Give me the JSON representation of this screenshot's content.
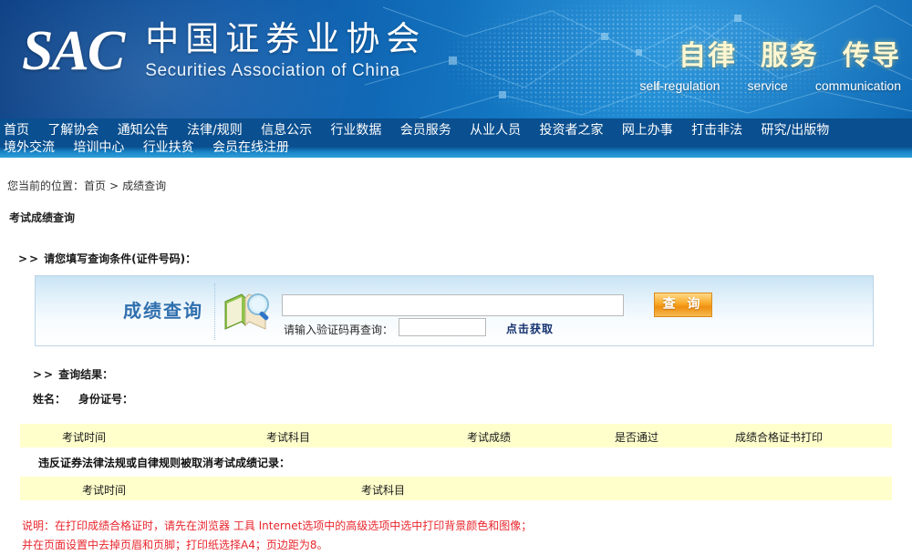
{
  "banner": {
    "logo_text": "SAC",
    "org_name_cn": "中国证券业协会",
    "org_name_en": "Securities Association of China",
    "slogans_cn": [
      "自律",
      "服务",
      "传导"
    ],
    "slogans_en": [
      "self-regulation",
      "service",
      "communication"
    ]
  },
  "nav": {
    "items": [
      "首页",
      "了解协会",
      "通知公告",
      "法律/规则",
      "信息公示",
      "行业数据",
      "会员服务",
      "从业人员",
      "投资者之家",
      "网上办事",
      "打击非法",
      "研究/出版物",
      "境外交流",
      "培训中心",
      "行业扶贫",
      "会员在线注册"
    ]
  },
  "breadcrumb": {
    "prefix": "您当前的位置：",
    "home": "首页",
    "separator": ">",
    "current": "成绩查询"
  },
  "page": {
    "section_title": "考试成绩查询",
    "condition_label": "请您填写查询条件(证件号码)：",
    "gt_marker": ">>"
  },
  "query_panel": {
    "title": "成绩查询",
    "icon": "book-search-icon",
    "id_input_value": "",
    "id_input_placeholder": "",
    "submit_label": "查 询",
    "captcha_label": "请输入验证码再查询：",
    "captcha_value": "",
    "captcha_refresh_label": "点击获取",
    "accent_color": "#f39c12"
  },
  "result": {
    "label": "查询结果：",
    "name_label": "姓名：",
    "id_label": "身份证号：",
    "name_value": "",
    "id_value": ""
  },
  "table_main": {
    "headers": [
      "考试时间",
      "考试科目",
      "考试成绩",
      "是否通过",
      "成绩合格证书打印"
    ],
    "header_bg": "#ffffcc",
    "rows": []
  },
  "violation": {
    "title": "违反证券法律法规或自律规则被取消考试成绩记录：",
    "headers": [
      "考试时间",
      "考试科目"
    ],
    "header_bg": "#ffffcc",
    "rows": []
  },
  "note": {
    "line1": "说明：在打印成绩合格证时，请先在浏览器 工具 Internet选项中的高级选项中选中打印背景颜色和图像；",
    "line2": "并在页面设置中去掉页眉和页脚；打印纸选择A4；页边距为8。",
    "color": "#e8262d"
  }
}
